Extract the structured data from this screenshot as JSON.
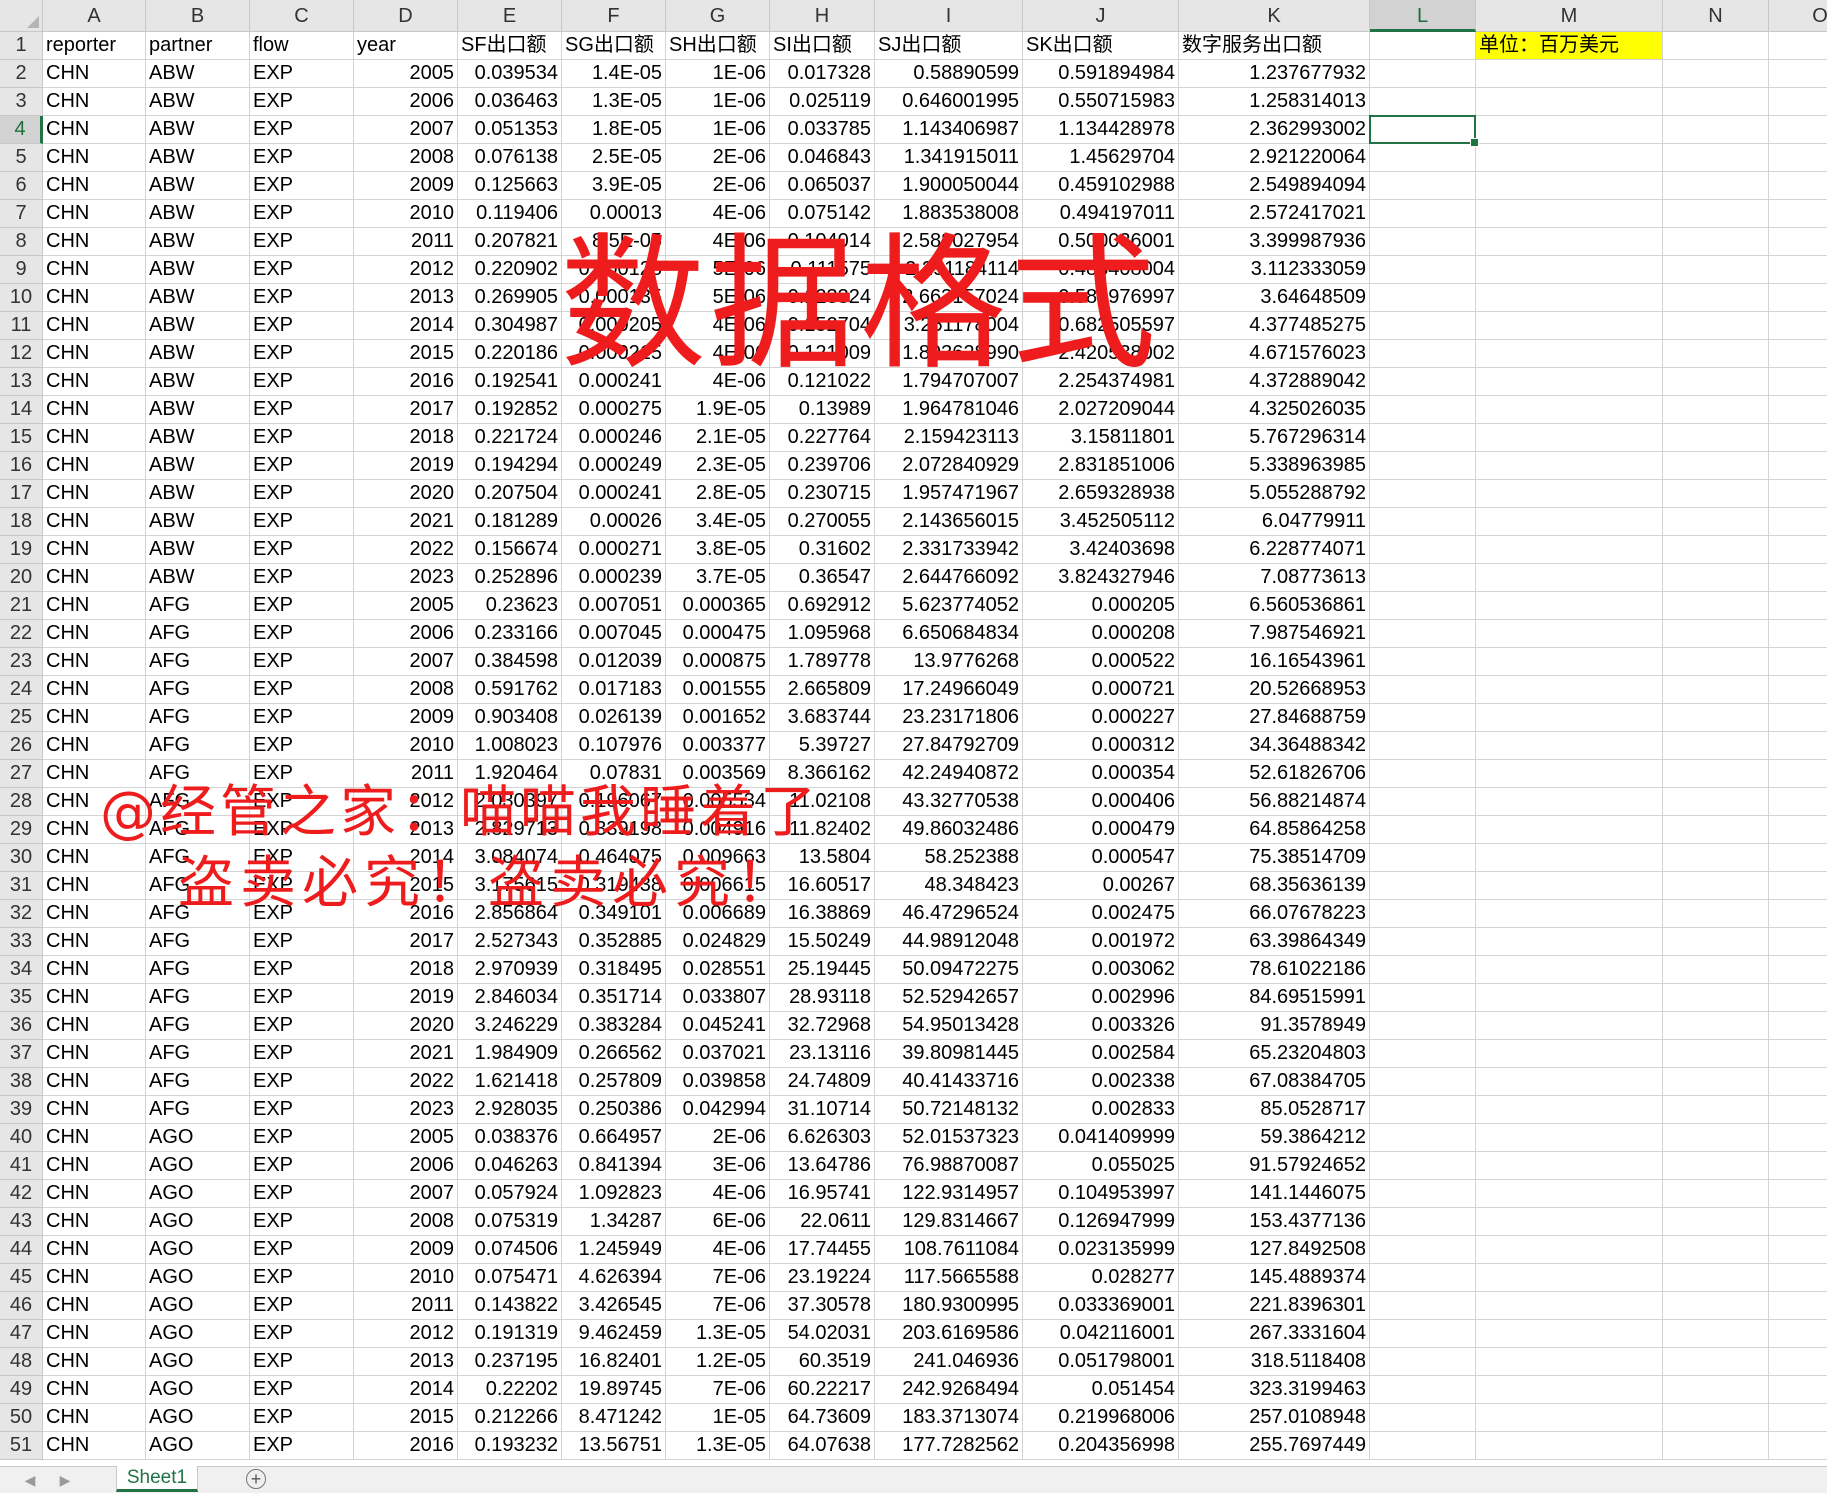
{
  "columns": [
    "A",
    "B",
    "C",
    "D",
    "E",
    "F",
    "G",
    "H",
    "I",
    "J",
    "K",
    "L",
    "M",
    "N",
    "O"
  ],
  "selected_cell": {
    "col": "L",
    "row": 4
  },
  "headers": [
    "reporter",
    "partner",
    "flow",
    "year",
    "SF出口额",
    "SG出口额",
    "SH出口额",
    "SI出口额",
    "SJ出口额",
    "SK出口额",
    "数字服务出口额"
  ],
  "unit_note": "单位：百万美元",
  "rows": [
    [
      "CHN",
      "ABW",
      "EXP",
      "2005",
      "0.039534",
      "1.4E-05",
      "1E-06",
      "0.017328",
      "0.58890599",
      "0.591894984",
      "1.237677932"
    ],
    [
      "CHN",
      "ABW",
      "EXP",
      "2006",
      "0.036463",
      "1.3E-05",
      "1E-06",
      "0.025119",
      "0.646001995",
      "0.550715983",
      "1.258314013"
    ],
    [
      "CHN",
      "ABW",
      "EXP",
      "2007",
      "0.051353",
      "1.8E-05",
      "1E-06",
      "0.033785",
      "1.143406987",
      "1.134428978",
      "2.362993002"
    ],
    [
      "CHN",
      "ABW",
      "EXP",
      "2008",
      "0.076138",
      "2.5E-05",
      "2E-06",
      "0.046843",
      "1.341915011",
      "1.45629704",
      "2.921220064"
    ],
    [
      "CHN",
      "ABW",
      "EXP",
      "2009",
      "0.125663",
      "3.9E-05",
      "2E-06",
      "0.065037",
      "1.900050044",
      "0.459102988",
      "2.549894094"
    ],
    [
      "CHN",
      "ABW",
      "EXP",
      "2010",
      "0.119406",
      "0.00013",
      "4E-06",
      "0.075142",
      "1.883538008",
      "0.494197011",
      "2.572417021"
    ],
    [
      "CHN",
      "ABW",
      "EXP",
      "2011",
      "0.207821",
      "8.5E-05",
      "4E-06",
      "0.104014",
      "2.588027954",
      "0.500036001",
      "3.399987936"
    ],
    [
      "CHN",
      "ABW",
      "EXP",
      "2012",
      "0.220902",
      "0.000128",
      "5E-06",
      "0.111575",
      "2.291184114",
      "0.483408004",
      "3.112333059"
    ],
    [
      "CHN",
      "ABW",
      "EXP",
      "2013",
      "0.269905",
      "0.000135",
      "5E-06",
      "0.123324",
      "2.663157024",
      "0.581976997",
      "3.64648509"
    ],
    [
      "CHN",
      "ABW",
      "EXP",
      "2014",
      "0.304987",
      "0.000205",
      "4E-06",
      "0.152704",
      "3.251178004",
      "0.682505597",
      "4.377485275"
    ],
    [
      "CHN",
      "ABW",
      "EXP",
      "2015",
      "0.220186",
      "0.000215",
      "4E-06",
      "0.121009",
      "1.893628990",
      "2.420538002",
      "4.671576023"
    ],
    [
      "CHN",
      "ABW",
      "EXP",
      "2016",
      "0.192541",
      "0.000241",
      "4E-06",
      "0.121022",
      "1.794707007",
      "2.254374981",
      "4.372889042"
    ],
    [
      "CHN",
      "ABW",
      "EXP",
      "2017",
      "0.192852",
      "0.000275",
      "1.9E-05",
      "0.13989",
      "1.964781046",
      "2.027209044",
      "4.325026035"
    ],
    [
      "CHN",
      "ABW",
      "EXP",
      "2018",
      "0.221724",
      "0.000246",
      "2.1E-05",
      "0.227764",
      "2.159423113",
      "3.15811801",
      "5.767296314"
    ],
    [
      "CHN",
      "ABW",
      "EXP",
      "2019",
      "0.194294",
      "0.000249",
      "2.3E-05",
      "0.239706",
      "2.072840929",
      "2.831851006",
      "5.338963985"
    ],
    [
      "CHN",
      "ABW",
      "EXP",
      "2020",
      "0.207504",
      "0.000241",
      "2.8E-05",
      "0.230715",
      "1.957471967",
      "2.659328938",
      "5.055288792"
    ],
    [
      "CHN",
      "ABW",
      "EXP",
      "2021",
      "0.181289",
      "0.00026",
      "3.4E-05",
      "0.270055",
      "2.143656015",
      "3.452505112",
      "6.04779911"
    ],
    [
      "CHN",
      "ABW",
      "EXP",
      "2022",
      "0.156674",
      "0.000271",
      "3.8E-05",
      "0.31602",
      "2.331733942",
      "3.42403698",
      "6.228774071"
    ],
    [
      "CHN",
      "ABW",
      "EXP",
      "2023",
      "0.252896",
      "0.000239",
      "3.7E-05",
      "0.36547",
      "2.644766092",
      "3.824327946",
      "7.08773613"
    ],
    [
      "CHN",
      "AFG",
      "EXP",
      "2005",
      "0.23623",
      "0.007051",
      "0.000365",
      "0.692912",
      "5.623774052",
      "0.000205",
      "6.560536861"
    ],
    [
      "CHN",
      "AFG",
      "EXP",
      "2006",
      "0.233166",
      "0.007045",
      "0.000475",
      "1.095968",
      "6.650684834",
      "0.000208",
      "7.987546921"
    ],
    [
      "CHN",
      "AFG",
      "EXP",
      "2007",
      "0.384598",
      "0.012039",
      "0.000875",
      "1.789778",
      "13.9776268",
      "0.000522",
      "16.16543961"
    ],
    [
      "CHN",
      "AFG",
      "EXP",
      "2008",
      "0.591762",
      "0.017183",
      "0.001555",
      "2.665809",
      "17.24966049",
      "0.000721",
      "20.52668953"
    ],
    [
      "CHN",
      "AFG",
      "EXP",
      "2009",
      "0.903408",
      "0.026139",
      "0.001652",
      "3.683744",
      "23.23171806",
      "0.000227",
      "27.84688759"
    ],
    [
      "CHN",
      "AFG",
      "EXP",
      "2010",
      "1.008023",
      "0.107976",
      "0.003377",
      "5.39727",
      "27.84792709",
      "0.000312",
      "34.36488342"
    ],
    [
      "CHN",
      "AFG",
      "EXP",
      "2011",
      "1.920464",
      "0.07831",
      "0.003569",
      "8.366162",
      "42.24940872",
      "0.000354",
      "52.61826706"
    ],
    [
      "CHN",
      "AFG",
      "EXP",
      "2012",
      "2.030397",
      "0.196067",
      "0.005534",
      "11.02108",
      "43.32770538",
      "0.000406",
      "56.88214874"
    ],
    [
      "CHN",
      "AFG",
      "EXP",
      "2013",
      "2.829713",
      "0.339198",
      "0.004916",
      "11.82402",
      "49.86032486",
      "0.000479",
      "64.85864258"
    ],
    [
      "CHN",
      "AFG",
      "EXP",
      "2014",
      "3.084074",
      "0.464075",
      "0.009663",
      "13.5804",
      "58.252388",
      "0.000547",
      "75.38514709"
    ],
    [
      "CHN",
      "AFG",
      "EXP",
      "2015",
      "3.175615",
      "0.319438",
      "0.006615",
      "16.60517",
      "48.348423",
      "0.00267",
      "68.35636139"
    ],
    [
      "CHN",
      "AFG",
      "EXP",
      "2016",
      "2.856864",
      "0.349101",
      "0.006689",
      "16.38869",
      "46.47296524",
      "0.002475",
      "66.07678223"
    ],
    [
      "CHN",
      "AFG",
      "EXP",
      "2017",
      "2.527343",
      "0.352885",
      "0.024829",
      "15.50249",
      "44.98912048",
      "0.001972",
      "63.39864349"
    ],
    [
      "CHN",
      "AFG",
      "EXP",
      "2018",
      "2.970939",
      "0.318495",
      "0.028551",
      "25.19445",
      "50.09472275",
      "0.003062",
      "78.61022186"
    ],
    [
      "CHN",
      "AFG",
      "EXP",
      "2019",
      "2.846034",
      "0.351714",
      "0.033807",
      "28.93118",
      "52.52942657",
      "0.002996",
      "84.69515991"
    ],
    [
      "CHN",
      "AFG",
      "EXP",
      "2020",
      "3.246229",
      "0.383284",
      "0.045241",
      "32.72968",
      "54.95013428",
      "0.003326",
      "91.3578949"
    ],
    [
      "CHN",
      "AFG",
      "EXP",
      "2021",
      "1.984909",
      "0.266562",
      "0.037021",
      "23.13116",
      "39.80981445",
      "0.002584",
      "65.23204803"
    ],
    [
      "CHN",
      "AFG",
      "EXP",
      "2022",
      "1.621418",
      "0.257809",
      "0.039858",
      "24.74809",
      "40.41433716",
      "0.002338",
      "67.08384705"
    ],
    [
      "CHN",
      "AFG",
      "EXP",
      "2023",
      "2.928035",
      "0.250386",
      "0.042994",
      "31.10714",
      "50.72148132",
      "0.002833",
      "85.0528717"
    ],
    [
      "CHN",
      "AGO",
      "EXP",
      "2005",
      "0.038376",
      "0.664957",
      "2E-06",
      "6.626303",
      "52.01537323",
      "0.041409999",
      "59.3864212"
    ],
    [
      "CHN",
      "AGO",
      "EXP",
      "2006",
      "0.046263",
      "0.841394",
      "3E-06",
      "13.64786",
      "76.98870087",
      "0.055025",
      "91.57924652"
    ],
    [
      "CHN",
      "AGO",
      "EXP",
      "2007",
      "0.057924",
      "1.092823",
      "4E-06",
      "16.95741",
      "122.9314957",
      "0.104953997",
      "141.1446075"
    ],
    [
      "CHN",
      "AGO",
      "EXP",
      "2008",
      "0.075319",
      "1.34287",
      "6E-06",
      "22.0611",
      "129.8314667",
      "0.126947999",
      "153.4377136"
    ],
    [
      "CHN",
      "AGO",
      "EXP",
      "2009",
      "0.074506",
      "1.245949",
      "4E-06",
      "17.74455",
      "108.7611084",
      "0.023135999",
      "127.8492508"
    ],
    [
      "CHN",
      "AGO",
      "EXP",
      "2010",
      "0.075471",
      "4.626394",
      "7E-06",
      "23.19224",
      "117.5665588",
      "0.028277",
      "145.4889374"
    ],
    [
      "CHN",
      "AGO",
      "EXP",
      "2011",
      "0.143822",
      "3.426545",
      "7E-06",
      "37.30578",
      "180.9300995",
      "0.033369001",
      "221.8396301"
    ],
    [
      "CHN",
      "AGO",
      "EXP",
      "2012",
      "0.191319",
      "9.462459",
      "1.3E-05",
      "54.02031",
      "203.6169586",
      "0.042116001",
      "267.3331604"
    ],
    [
      "CHN",
      "AGO",
      "EXP",
      "2013",
      "0.237195",
      "16.82401",
      "1.2E-05",
      "60.3519",
      "241.046936",
      "0.051798001",
      "318.5118408"
    ],
    [
      "CHN",
      "AGO",
      "EXP",
      "2014",
      "0.22202",
      "19.89745",
      "7E-06",
      "60.22217",
      "242.9268494",
      "0.051454",
      "323.3199463"
    ],
    [
      "CHN",
      "AGO",
      "EXP",
      "2015",
      "0.212266",
      "8.471242",
      "1E-05",
      "64.73609",
      "183.3713074",
      "0.219968006",
      "257.0108948"
    ],
    [
      "CHN",
      "AGO",
      "EXP",
      "2016",
      "0.193232",
      "13.56751",
      "1.3E-05",
      "64.07638",
      "177.7282562",
      "0.204356998",
      "255.7697449"
    ]
  ],
  "watermark": {
    "big": "数据格式",
    "line1": "@经管之家：喵喵我睡着了",
    "line2": "盗卖必究！盗卖必究！"
  },
  "tabs": {
    "sheet_name": "Sheet1",
    "add_label": "+",
    "prev_label": "◀",
    "next_label": "▶"
  }
}
